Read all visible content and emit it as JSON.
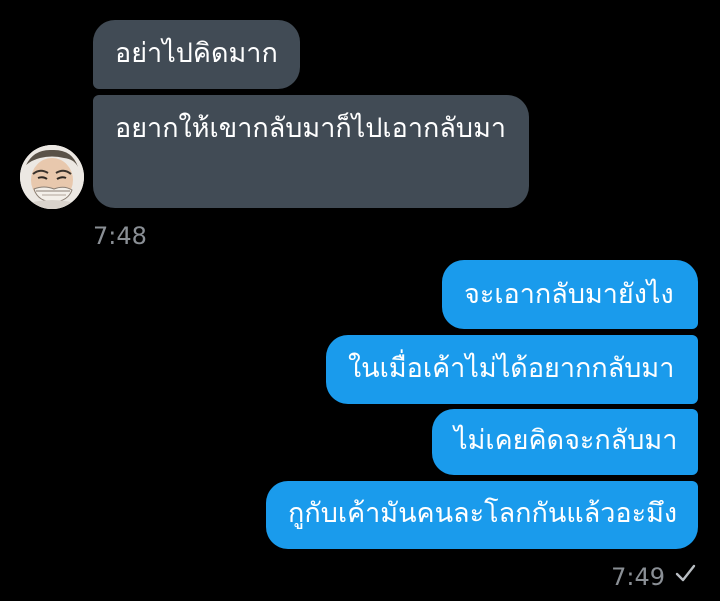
{
  "conversation": {
    "incoming": [
      {
        "text": "อย่าไปคิดมาก"
      },
      {
        "text": "อยากให้เขากลับมาก็ไปเอากลับมา"
      }
    ],
    "incoming_time": "7:48",
    "outgoing": [
      {
        "text": "จะเอากลับมายังไง"
      },
      {
        "text": "ในเมื่อเค้าไม่ได้อยากกลับมา"
      },
      {
        "text": "ไม่เคยคิดจะกลับมา"
      },
      {
        "text": "กูกับเค้ามันคนละโลกกันแล้วอะมึง"
      }
    ],
    "outgoing_time": "7:49",
    "read_status_icon": "checkmark-icon"
  },
  "colors": {
    "background": "#000000",
    "incoming_bubble": "#414b55",
    "outgoing_bubble": "#1a9bec",
    "timestamp": "#8a8f95"
  }
}
